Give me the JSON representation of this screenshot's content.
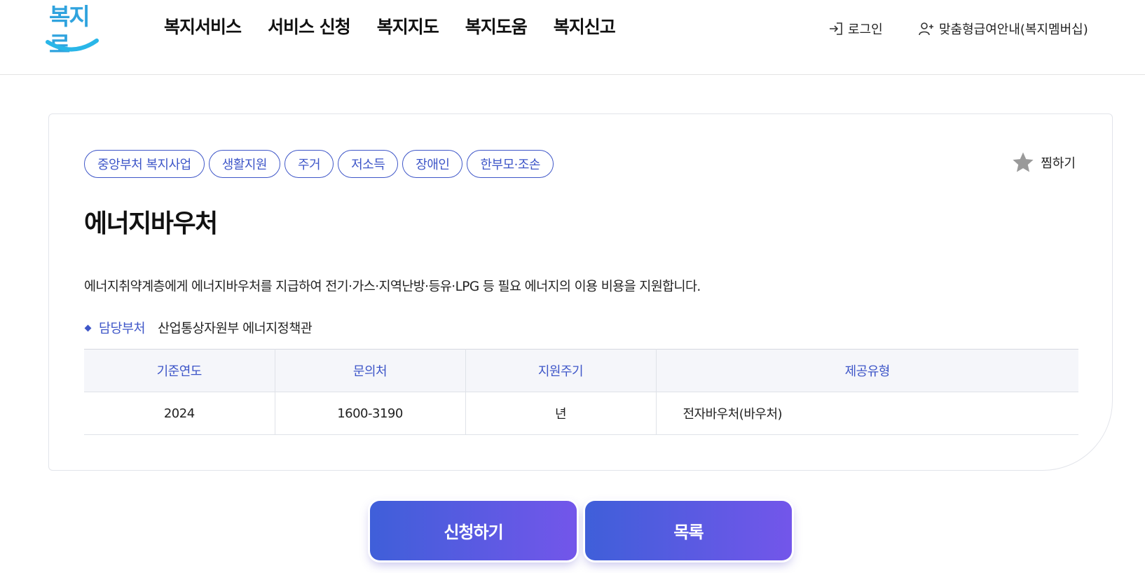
{
  "header": {
    "logo_text": "복지로",
    "nav": [
      "복지서비스",
      "서비스 신청",
      "복지지도",
      "복지도움",
      "복지신고"
    ],
    "login_label": "로그인",
    "membership_label": "맞춤형급여안내(복지멤버십)"
  },
  "service": {
    "tags": [
      "중앙부처 복지사업",
      "생활지원",
      "주거",
      "저소득",
      "장애인",
      "한부모·조손"
    ],
    "favorite_label": "찜하기",
    "title": "에너지바우처",
    "description": "에너지취약계층에게 에너지바우처를 지급하여 전기·가스·지역난방·등유·LPG 등 필요 에너지의 이용 비용을 지원합니다.",
    "dept_label": "담당부처",
    "dept_value": "산업통상자원부 에너지정책관",
    "table": {
      "headers": [
        "기준연도",
        "문의처",
        "지원주기",
        "제공유형"
      ],
      "row": [
        "2024",
        "1600-3190",
        "년",
        "전자바우처(바우처)"
      ]
    }
  },
  "buttons": {
    "apply": "신청하기",
    "list": "목록"
  },
  "colors": {
    "accent": "#3e56c8",
    "logo": "#2fa3de",
    "button_gradient_start": "#3f5fd9",
    "button_gradient_end": "#7356ea"
  }
}
